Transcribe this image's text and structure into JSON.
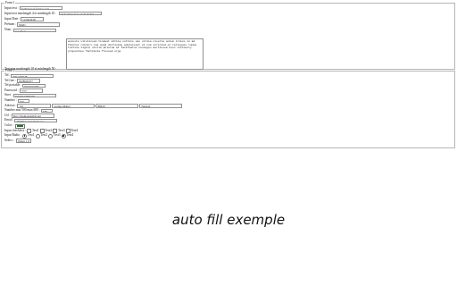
{
  "form1": {
    "legend": "Form 1",
    "input_text": {
      "label": "Input text :",
      "value": "facilisis non feruisa quat"
    },
    "input_text_min_max": {
      "label": "Input text maxlength 4 et minlength 10 :",
      "value": "dusfacilisis fuctoria facheltul"
    },
    "input_date": {
      "label": "Input Date :",
      "value": "11/06/2018"
    },
    "prenom": {
      "label": "Prénom :",
      "value": "Molly"
    },
    "nom": {
      "label": "Nom :",
      "value": "reconfort"
    },
    "textarea": {
      "label": "Textarea maxlength 10 et minlength 50 :",
      "value": "accusto vitulinuum tindeat attila nuttine ume villia cisella autem illico in ad facutus rubnirs cum quod dortiscme adnisisset et cum stricted et collegues lumia tustina tigins stella dolorum at facifiatus conloges dortissem hesc vnitoenly propostine factibula frussed urge"
    }
  },
  "form2": {
    "legend": "Form 2",
    "tel": {
      "label": "Tel :",
      "value": "0691496028"
    },
    "tel_fixe": {
      "label": "Tel fixe :",
      "value": "0328026477"
    },
    "tel_portable": {
      "label": "Tel portable :",
      "value": "0644601068"
    },
    "password": {
      "label": "Password :",
      "value": "••••••"
    },
    "siret": {
      "label": "Siret :",
      "value": "46049532800039"
    },
    "number": {
      "label": "Number :",
      "value": "269"
    },
    "adresse": {
      "label": "Adresse :",
      "number": "101",
      "street": "avenue Matter",
      "zip": "88220",
      "city": "Nespret"
    },
    "number_range": {
      "label": "Number min 500 max 600 :",
      "value": "538"
    },
    "url": {
      "label": "Url :",
      "value": "http://deamonsaisble.net"
    },
    "email": {
      "label": "Email :",
      "value": "39089plsd@l@mail.net"
    },
    "color": {
      "label": "Color :",
      "value": "#1f7a2a"
    },
    "checkbox": {
      "label": "Input checkbox :",
      "options": [
        "Test1",
        "Test2",
        "Test3",
        "Test4"
      ]
    },
    "radio": {
      "label": "Input Radio :",
      "options": [
        "Test1",
        "Test2",
        "Test3",
        "Test4"
      ],
      "checked": [
        true,
        false,
        false,
        true
      ]
    },
    "select": {
      "label": "Select :",
      "value": "Valeur 1",
      "arrow": "▾"
    }
  },
  "tagline": "auto fill exemple"
}
